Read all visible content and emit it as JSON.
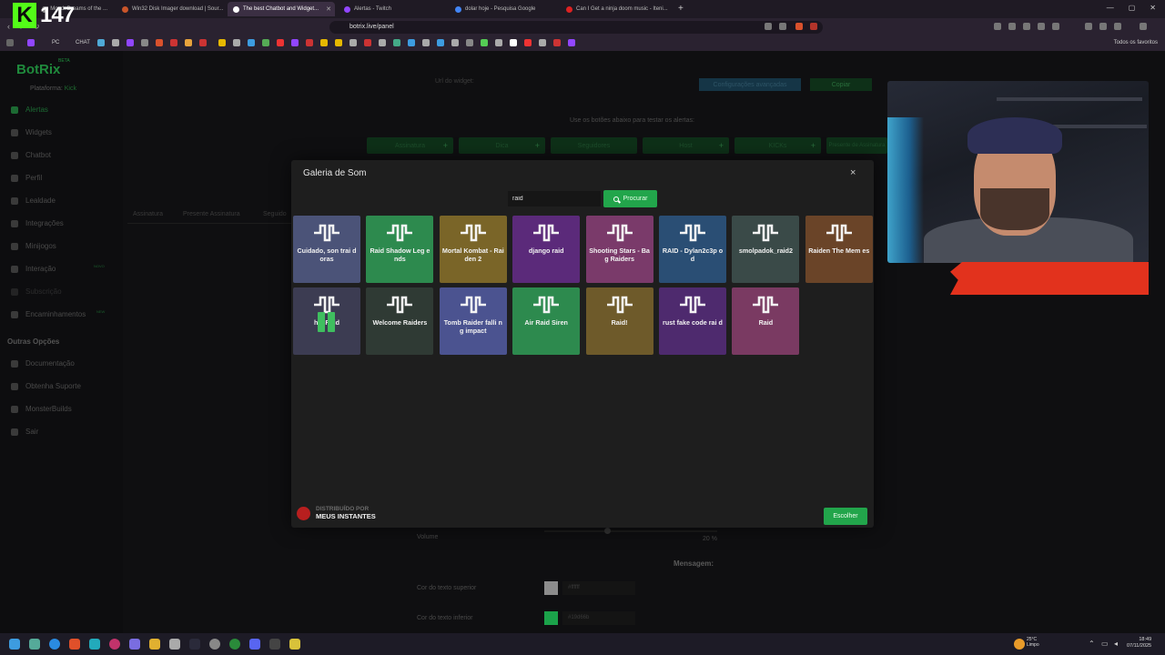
{
  "browser": {
    "tabs": [
      {
        "label": "Mood: Dreams of the ...",
        "active": false
      },
      {
        "label": "Win32 Disk Imager download | Sour...",
        "active": false
      },
      {
        "label": "The best Chatbot and Widget...",
        "active": true
      },
      {
        "label": "Alertas - Twitch",
        "active": false
      },
      {
        "label": "dolar hoje - Pesquisa Google",
        "active": false
      },
      {
        "label": "Can I Get a ninja doom music - Iteni...",
        "active": false
      }
    ],
    "new_tab": "+",
    "url": "botrix.live/panel",
    "bookmarks": [
      "PC",
      "CHAT"
    ],
    "all_favorites": "Todos os favoritos",
    "channel_logo_letter": "K",
    "channel_logo_number": "147"
  },
  "sidebar": {
    "brand": "BotRix",
    "brand_tag": "BETA",
    "platform_label": "Plataforma:",
    "platform_value": "Kick",
    "items": [
      {
        "label": "Alertas",
        "active": true
      },
      {
        "label": "Widgets"
      },
      {
        "label": "Chatbot"
      },
      {
        "label": "Perfil"
      },
      {
        "label": "Lealdade"
      },
      {
        "label": "Integrações"
      },
      {
        "label": "Minijogos"
      },
      {
        "label": "Interação",
        "badge": "NOVO"
      },
      {
        "label": "Subscrição"
      },
      {
        "label": "Encaminhamentos",
        "badge": "NEW"
      }
    ],
    "section_title": "Outras Opções",
    "other_items": [
      {
        "label": "Documentação"
      },
      {
        "label": "Obtenha Suporte"
      },
      {
        "label": "MonsterBuilds"
      },
      {
        "label": "Sair"
      }
    ]
  },
  "background": {
    "widget_url_label": "Url do widget:",
    "advanced_settings": "Configurações avançadas",
    "copy": "Copiar",
    "test_hint": "Use os botões abaixo para testar os alertas:",
    "test_buttons": [
      "Assinatura",
      "Dica",
      "Seguidores",
      "Host",
      "KICKs",
      "Presente de Assinatura"
    ],
    "tabs": [
      "Assinatura",
      "Presente Assinatura",
      "Seguido"
    ],
    "volume_label": "Volume",
    "volume_value": "20 %",
    "volume_level": 0.35,
    "message_title": "Mensagem:",
    "top_color_label": "Cor do texto superior",
    "top_color_value": "#ffffff",
    "bottom_color_label": "Cor do texto inferior",
    "bottom_color_value": "#19d66b"
  },
  "modal": {
    "title": "Galeria de Som",
    "close": "×",
    "search_value": "raid",
    "search_button": "Procurar",
    "sounds": [
      {
        "label": "Cuidado, son trai doras",
        "color": "#4b5378"
      },
      {
        "label": "Raid Shadow Leg ends",
        "color": "#2d8a4e"
      },
      {
        "label": "Mortal Kombat - Raiden 2",
        "color": "#7a6528"
      },
      {
        "label": "django raid",
        "color": "#5b2a7a"
      },
      {
        "label": "Shooting Stars - Bag Raiders",
        "color": "#7a3a6a"
      },
      {
        "label": "RAID - Dylan2c3p od",
        "color": "#2a4e74"
      },
      {
        "label": "smolpadok_raid2",
        "color": "#3a4a48"
      },
      {
        "label": "Raiden The Mem es",
        "color": "#6a4428"
      },
      {
        "label": "hasRaid",
        "color": "#3c3c52",
        "playing": true
      },
      {
        "label": "Welcome Raiders",
        "color": "#2f3a34"
      },
      {
        "label": "Tomb Raider falli ng impact",
        "color": "#4b5390"
      },
      {
        "label": "Air Raid Siren",
        "color": "#2d8a4e"
      },
      {
        "label": "Raid!",
        "color": "#6e5a2a"
      },
      {
        "label": "rust fake code rai d",
        "color": "#4e2a6e"
      },
      {
        "label": "Raid",
        "color": "#7a3a62"
      }
    ],
    "footer_brand_line1": "DISTRIBUÍDO POR",
    "footer_brand_line2": "MEUS INSTANTES",
    "choose_button": "Escolher"
  },
  "taskbar": {
    "weather_temp": "25°C",
    "weather_desc": "Limpo",
    "time": "18:49",
    "date": "07/11/2025"
  }
}
